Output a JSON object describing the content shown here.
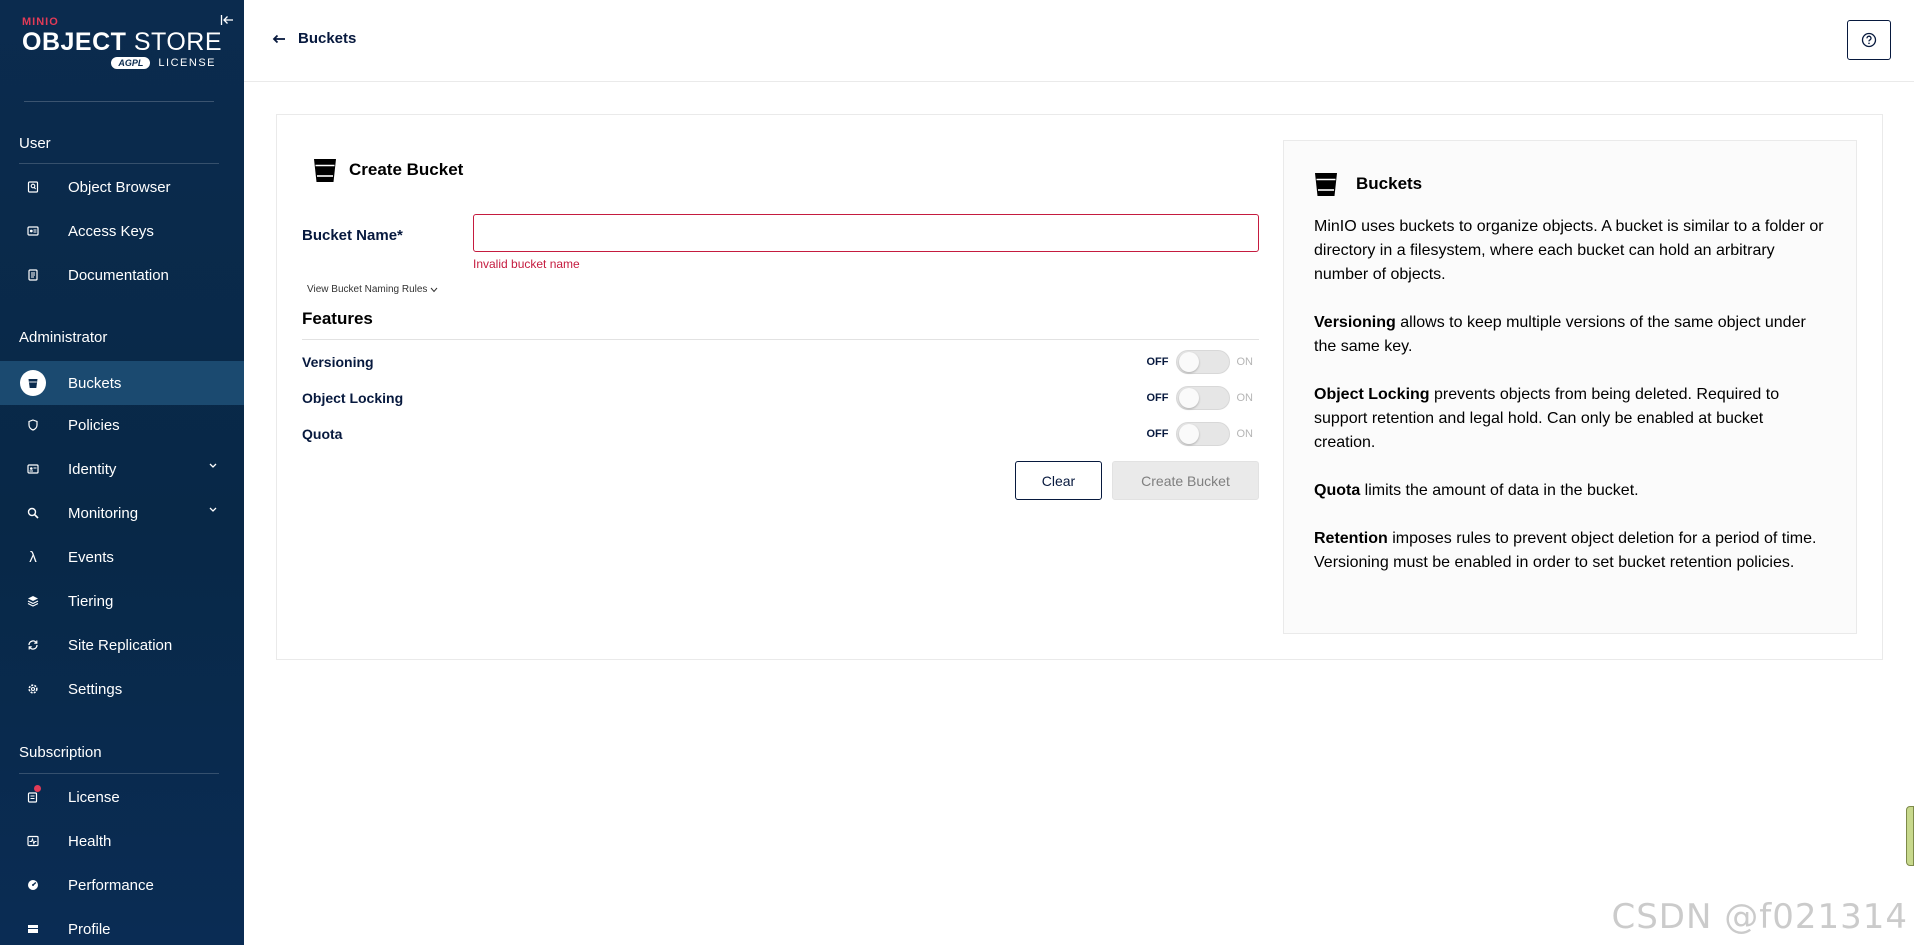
{
  "logo": {
    "brand_small": "MINIO",
    "brand_big_bold": "OBJECT",
    "brand_big_light": "STORE",
    "agpl": "AGPL",
    "license": "LICENSE"
  },
  "sidebar": {
    "sections": [
      {
        "title": "User",
        "items": [
          {
            "label": "Object Browser",
            "icon": "object-browser-icon"
          },
          {
            "label": "Access Keys",
            "icon": "access-keys-icon"
          },
          {
            "label": "Documentation",
            "icon": "documentation-icon"
          }
        ]
      },
      {
        "title": "Administrator",
        "items": [
          {
            "label": "Buckets",
            "icon": "bucket-icon",
            "active": true
          },
          {
            "label": "Policies",
            "icon": "policies-icon"
          },
          {
            "label": "Identity",
            "icon": "identity-icon",
            "expandable": true
          },
          {
            "label": "Monitoring",
            "icon": "monitoring-icon",
            "expandable": true
          },
          {
            "label": "Events",
            "icon": "lambda-icon"
          },
          {
            "label": "Tiering",
            "icon": "tiering-icon"
          },
          {
            "label": "Site Replication",
            "icon": "replication-icon"
          },
          {
            "label": "Settings",
            "icon": "gear-icon"
          }
        ]
      },
      {
        "title": "Subscription",
        "items": [
          {
            "label": "License",
            "icon": "license-icon"
          },
          {
            "label": "Health",
            "icon": "health-icon"
          },
          {
            "label": "Performance",
            "icon": "performance-icon"
          },
          {
            "label": "Profile",
            "icon": "profile-icon"
          }
        ]
      }
    ]
  },
  "header": {
    "back_label": "Buckets"
  },
  "form": {
    "title": "Create Bucket",
    "bucket_name_label": "Bucket Name*",
    "bucket_name_value": "",
    "error": "Invalid bucket name",
    "rules_link": "View Bucket Naming Rules",
    "features_title": "Features",
    "features": [
      {
        "label": "Versioning",
        "off": "OFF",
        "on": "ON",
        "enabled": false
      },
      {
        "label": "Object Locking",
        "off": "OFF",
        "on": "ON",
        "enabled": false
      },
      {
        "label": "Quota",
        "off": "OFF",
        "on": "ON",
        "enabled": false
      }
    ],
    "clear_label": "Clear",
    "create_label": "Create Bucket"
  },
  "help": {
    "title": "Buckets",
    "intro": "MinIO uses buckets to organize objects. A bucket is similar to a folder or directory in a filesystem, where each bucket can hold an arbitrary number of objects.",
    "versioning_term": "Versioning",
    "versioning_text": " allows to keep multiple versions of the same object under the same key.",
    "locking_term": "Object Locking",
    "locking_text": " prevents objects from being deleted. Required to support retention and legal hold. Can only be enabled at bucket creation.",
    "quota_term": "Quota",
    "quota_text": " limits the amount of data in the bucket.",
    "retention_term": "Retention",
    "retention_text": " imposes rules to prevent object deletion for a period of time. Versioning must be enabled in order to set bucket retention policies."
  },
  "watermark": "CSDN @f021314"
}
